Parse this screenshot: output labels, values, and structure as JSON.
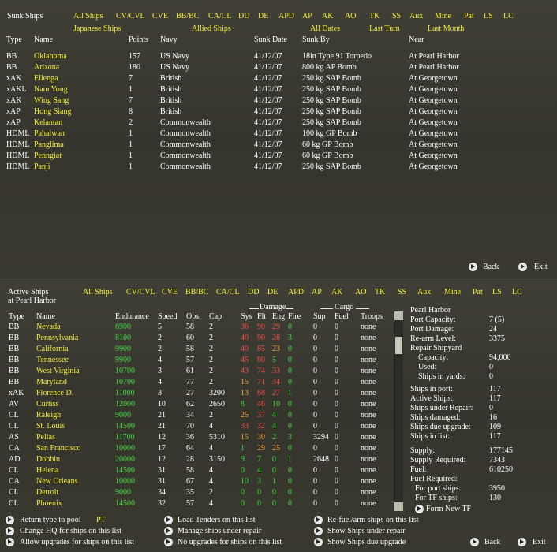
{
  "top": {
    "title": "Sunk Ships",
    "filters_row1": [
      "All Ships",
      "CV/CVL",
      "CVE",
      "BB/BC",
      "CA/CL",
      "DD",
      "DE",
      "APD",
      "AP",
      "AK",
      "AO",
      "TK",
      "SS",
      "Aux",
      "Mine",
      "Pat",
      "LS",
      "LC"
    ],
    "filters_row2": [
      "Japanese Ships",
      "Allied Ships",
      "All Dates",
      "Last Turn",
      "Last Month"
    ],
    "columns": [
      "Type",
      "Name",
      "Points",
      "Navy",
      "Sunk Date",
      "Sunk By",
      "Near"
    ],
    "rows": [
      [
        "BB",
        "Oklahoma",
        "157",
        "US Navy",
        "41/12/07",
        "18in Type 91 Torpedo",
        "At Pearl Harbor"
      ],
      [
        "BB",
        "Arizona",
        "180",
        "US Navy",
        "41/12/07",
        "800 kg AP Bomb",
        "At Pearl Harbor"
      ],
      [
        "xAK",
        "Ellenga",
        "7",
        "British",
        "41/12/07",
        "250 kg SAP Bomb",
        "At Georgetown"
      ],
      [
        "xAKL",
        "Nam Yong",
        "1",
        "British",
        "41/12/07",
        "250 kg SAP Bomb",
        "At Georgetown"
      ],
      [
        "xAK",
        "Wing Sang",
        "7",
        "British",
        "41/12/07",
        "250 kg SAP Bomb",
        "At Georgetown"
      ],
      [
        "xAP",
        "Hong Siang",
        "8",
        "British",
        "41/12/07",
        "250 kg SAP Bomb",
        "At Georgetown"
      ],
      [
        "xAP",
        "Kelantan",
        "2",
        "Commonwealth",
        "41/12/07",
        "250 kg SAP Bomb",
        "At Georgetown"
      ],
      [
        "HDML",
        "Pahalwan",
        "1",
        "Commonwealth",
        "41/12/07",
        "100 kg GP Bomb",
        "At Georgetown"
      ],
      [
        "HDML",
        "Panglima",
        "1",
        "Commonwealth",
        "41/12/07",
        "60 kg GP Bomb",
        "At Georgetown"
      ],
      [
        "HDML",
        "Penngiat",
        "1",
        "Commonwealth",
        "41/12/07",
        "60 kg GP Bomb",
        "At Georgetown"
      ],
      [
        "HDML",
        "Panji",
        "1",
        "Commonwealth",
        "41/12/07",
        "250 kg SAP Bomb",
        "At Georgetown"
      ]
    ],
    "back_label": "Back",
    "exit_label": "Exit"
  },
  "bottom": {
    "title_line1": "Active Ships",
    "title_line2": "at Pearl Harbor",
    "filters": [
      "All Ships",
      "CV/CVL",
      "CVE",
      "BB/BC",
      "CA/CL",
      "DD",
      "DE",
      "APD",
      "AP",
      "AK",
      "AO",
      "TK",
      "SS",
      "Aux",
      "Mine",
      "Pat",
      "LS",
      "LC"
    ],
    "group_damage": "Damage",
    "group_cargo": "Cargo",
    "columns": [
      "Type",
      "Name",
      "Endurance",
      "Speed",
      "Ops",
      "Cap",
      "Sys",
      "Flt",
      "Eng",
      "Fire",
      "Sup",
      "Fuel",
      "Troops"
    ],
    "rows": [
      [
        "BB",
        "Nevada",
        "6900",
        "5",
        "58",
        "2",
        "36",
        "90",
        "29",
        "0",
        "0",
        "0",
        "none"
      ],
      [
        "BB",
        "Pennsylvania",
        "8100",
        "2",
        "60",
        "2",
        "40",
        "90",
        "28",
        "3",
        "0",
        "0",
        "none"
      ],
      [
        "BB",
        "California",
        "9900",
        "2",
        "58",
        "2",
        "40",
        "85",
        "23",
        "0",
        "0",
        "0",
        "none"
      ],
      [
        "BB",
        "Tennessee",
        "9900",
        "4",
        "57",
        "2",
        "45",
        "80",
        "5",
        "0",
        "0",
        "0",
        "none"
      ],
      [
        "BB",
        "West Virginia",
        "10700",
        "3",
        "61",
        "2",
        "43",
        "74",
        "33",
        "0",
        "0",
        "0",
        "none"
      ],
      [
        "BB",
        "Maryland",
        "10700",
        "4",
        "77",
        "2",
        "15",
        "71",
        "34",
        "0",
        "0",
        "0",
        "none"
      ],
      [
        "xAK",
        "Florence D.",
        "11000",
        "3",
        "27",
        "3200",
        "13",
        "68",
        "27",
        "1",
        "0",
        "0",
        "none"
      ],
      [
        "AV",
        "Curtiss",
        "12000",
        "10",
        "62",
        "2650",
        "8",
        "46",
        "10",
        "0",
        "0",
        "0",
        "none"
      ],
      [
        "CL",
        "Raleigh",
        "9000",
        "21",
        "34",
        "2",
        "25",
        "37",
        "4",
        "0",
        "0",
        "0",
        "none"
      ],
      [
        "CL",
        "St. Louis",
        "14500",
        "21",
        "70",
        "4",
        "33",
        "32",
        "4",
        "0",
        "0",
        "0",
        "none"
      ],
      [
        "AS",
        "Pelias",
        "11700",
        "12",
        "36",
        "5310",
        "15",
        "30",
        "2",
        "3",
        "3294",
        "0",
        "none"
      ],
      [
        "CA",
        "San Francisco",
        "10000",
        "17",
        "64",
        "4",
        "1",
        "29",
        "25",
        "0",
        "0",
        "0",
        "none"
      ],
      [
        "AD",
        "Dobbin",
        "20000",
        "12",
        "28",
        "3150",
        "9",
        "7",
        "0",
        "1",
        "2648",
        "0",
        "none"
      ],
      [
        "CL",
        "Helena",
        "14500",
        "31",
        "58",
        "4",
        "0",
        "4",
        "0",
        "0",
        "0",
        "0",
        "none"
      ],
      [
        "CA",
        "New Orleans",
        "10000",
        "31",
        "67",
        "4",
        "10",
        "3",
        "1",
        "0",
        "0",
        "0",
        "none"
      ],
      [
        "CL",
        "Detroit",
        "9000",
        "34",
        "35",
        "2",
        "0",
        "0",
        "0",
        "0",
        "0",
        "0",
        "none"
      ],
      [
        "CL",
        "Phoenix",
        "14500",
        "32",
        "57",
        "4",
        "0",
        "0",
        "0",
        "0",
        "0",
        "0",
        "none"
      ]
    ],
    "port": {
      "name": "Pearl Harbor",
      "capacity_label": "Port Capacity:",
      "capacity": "7 (5)",
      "damage_label": "Port Damage:",
      "damage": "24",
      "rearm_label": "Re-arm Level:",
      "rearm": "3375",
      "shipyard_label": "Repair Shipyard",
      "sy_capacity_label": "Capacity:",
      "sy_capacity": "94,000",
      "sy_used_label": "Used:",
      "sy_used": "0",
      "sy_yards_label": "Ships in yards:",
      "sy_yards": "0",
      "in_port_label": "Ships in port:",
      "in_port": "117",
      "active_label": "Active Ships:",
      "active": "117",
      "under_repair_label": "Ships under Repair:",
      "under_repair": "0",
      "damaged_label": "Ships damaged:",
      "damaged": "16",
      "due_upgrade_label": "Ships due upgrade:",
      "due_upgrade": "109",
      "in_list_label": "Ships in list:",
      "in_list": "117",
      "supply_label": "Supply:",
      "supply": "177145",
      "supply_req_label": "Supply Required:",
      "supply_req": "7343",
      "fuel_label": "Fuel:",
      "fuel": "610250",
      "fuel_req_label": "Fuel Required:",
      "port_ships_label": "For port ships:",
      "port_ships": "3950",
      "tf_ships_label": "For TF ships:",
      "tf_ships": "130"
    },
    "form_tf_label": "Form New TF",
    "actions": {
      "return_type": "Return type to pool",
      "return_type_value": "PT",
      "change_hq": "Change HQ for ships on this list",
      "allow_upgrades": "Allow upgrades for ships on this list",
      "load_tenders": "Load Tenders on this list",
      "manage_repair": "Manage ships under repair",
      "no_upgrades": "No upgrades for ships on this list",
      "refuel": "Re-fuel/arm ships on this list",
      "show_repair": "Show Ships under repair",
      "show_upgrade": "Show Ships due upgrade"
    },
    "back_label": "Back",
    "exit_label": "Exit"
  },
  "colors": {
    "yellow": "#f2ef3c",
    "green": "#3fd83f",
    "red": "#f0504a",
    "orange": "#f0a23a",
    "white": "#ffffff",
    "background": "#3c3b32"
  }
}
